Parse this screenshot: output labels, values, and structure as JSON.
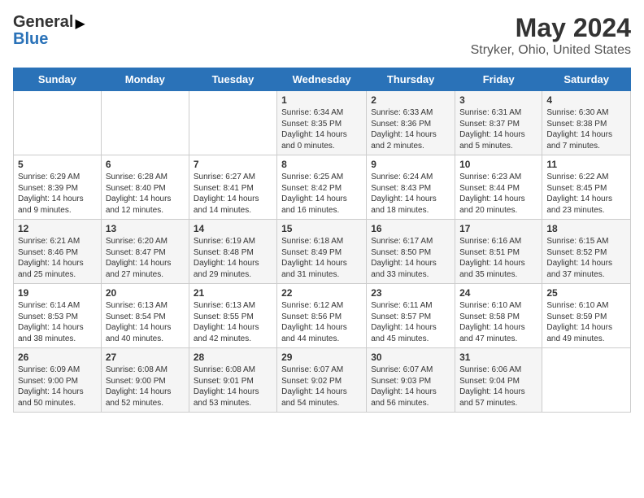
{
  "header": {
    "logo_general": "General",
    "logo_blue": "Blue",
    "title": "May 2024",
    "subtitle": "Stryker, Ohio, United States"
  },
  "days_of_week": [
    "Sunday",
    "Monday",
    "Tuesday",
    "Wednesday",
    "Thursday",
    "Friday",
    "Saturday"
  ],
  "weeks": [
    [
      {
        "day": "",
        "content": ""
      },
      {
        "day": "",
        "content": ""
      },
      {
        "day": "",
        "content": ""
      },
      {
        "day": "1",
        "content": "Sunrise: 6:34 AM\nSunset: 8:35 PM\nDaylight: 14 hours\nand 0 minutes."
      },
      {
        "day": "2",
        "content": "Sunrise: 6:33 AM\nSunset: 8:36 PM\nDaylight: 14 hours\nand 2 minutes."
      },
      {
        "day": "3",
        "content": "Sunrise: 6:31 AM\nSunset: 8:37 PM\nDaylight: 14 hours\nand 5 minutes."
      },
      {
        "day": "4",
        "content": "Sunrise: 6:30 AM\nSunset: 8:38 PM\nDaylight: 14 hours\nand 7 minutes."
      }
    ],
    [
      {
        "day": "5",
        "content": "Sunrise: 6:29 AM\nSunset: 8:39 PM\nDaylight: 14 hours\nand 9 minutes."
      },
      {
        "day": "6",
        "content": "Sunrise: 6:28 AM\nSunset: 8:40 PM\nDaylight: 14 hours\nand 12 minutes."
      },
      {
        "day": "7",
        "content": "Sunrise: 6:27 AM\nSunset: 8:41 PM\nDaylight: 14 hours\nand 14 minutes."
      },
      {
        "day": "8",
        "content": "Sunrise: 6:25 AM\nSunset: 8:42 PM\nDaylight: 14 hours\nand 16 minutes."
      },
      {
        "day": "9",
        "content": "Sunrise: 6:24 AM\nSunset: 8:43 PM\nDaylight: 14 hours\nand 18 minutes."
      },
      {
        "day": "10",
        "content": "Sunrise: 6:23 AM\nSunset: 8:44 PM\nDaylight: 14 hours\nand 20 minutes."
      },
      {
        "day": "11",
        "content": "Sunrise: 6:22 AM\nSunset: 8:45 PM\nDaylight: 14 hours\nand 23 minutes."
      }
    ],
    [
      {
        "day": "12",
        "content": "Sunrise: 6:21 AM\nSunset: 8:46 PM\nDaylight: 14 hours\nand 25 minutes."
      },
      {
        "day": "13",
        "content": "Sunrise: 6:20 AM\nSunset: 8:47 PM\nDaylight: 14 hours\nand 27 minutes."
      },
      {
        "day": "14",
        "content": "Sunrise: 6:19 AM\nSunset: 8:48 PM\nDaylight: 14 hours\nand 29 minutes."
      },
      {
        "day": "15",
        "content": "Sunrise: 6:18 AM\nSunset: 8:49 PM\nDaylight: 14 hours\nand 31 minutes."
      },
      {
        "day": "16",
        "content": "Sunrise: 6:17 AM\nSunset: 8:50 PM\nDaylight: 14 hours\nand 33 minutes."
      },
      {
        "day": "17",
        "content": "Sunrise: 6:16 AM\nSunset: 8:51 PM\nDaylight: 14 hours\nand 35 minutes."
      },
      {
        "day": "18",
        "content": "Sunrise: 6:15 AM\nSunset: 8:52 PM\nDaylight: 14 hours\nand 37 minutes."
      }
    ],
    [
      {
        "day": "19",
        "content": "Sunrise: 6:14 AM\nSunset: 8:53 PM\nDaylight: 14 hours\nand 38 minutes."
      },
      {
        "day": "20",
        "content": "Sunrise: 6:13 AM\nSunset: 8:54 PM\nDaylight: 14 hours\nand 40 minutes."
      },
      {
        "day": "21",
        "content": "Sunrise: 6:13 AM\nSunset: 8:55 PM\nDaylight: 14 hours\nand 42 minutes."
      },
      {
        "day": "22",
        "content": "Sunrise: 6:12 AM\nSunset: 8:56 PM\nDaylight: 14 hours\nand 44 minutes."
      },
      {
        "day": "23",
        "content": "Sunrise: 6:11 AM\nSunset: 8:57 PM\nDaylight: 14 hours\nand 45 minutes."
      },
      {
        "day": "24",
        "content": "Sunrise: 6:10 AM\nSunset: 8:58 PM\nDaylight: 14 hours\nand 47 minutes."
      },
      {
        "day": "25",
        "content": "Sunrise: 6:10 AM\nSunset: 8:59 PM\nDaylight: 14 hours\nand 49 minutes."
      }
    ],
    [
      {
        "day": "26",
        "content": "Sunrise: 6:09 AM\nSunset: 9:00 PM\nDaylight: 14 hours\nand 50 minutes."
      },
      {
        "day": "27",
        "content": "Sunrise: 6:08 AM\nSunset: 9:00 PM\nDaylight: 14 hours\nand 52 minutes."
      },
      {
        "day": "28",
        "content": "Sunrise: 6:08 AM\nSunset: 9:01 PM\nDaylight: 14 hours\nand 53 minutes."
      },
      {
        "day": "29",
        "content": "Sunrise: 6:07 AM\nSunset: 9:02 PM\nDaylight: 14 hours\nand 54 minutes."
      },
      {
        "day": "30",
        "content": "Sunrise: 6:07 AM\nSunset: 9:03 PM\nDaylight: 14 hours\nand 56 minutes."
      },
      {
        "day": "31",
        "content": "Sunrise: 6:06 AM\nSunset: 9:04 PM\nDaylight: 14 hours\nand 57 minutes."
      },
      {
        "day": "",
        "content": ""
      }
    ]
  ]
}
